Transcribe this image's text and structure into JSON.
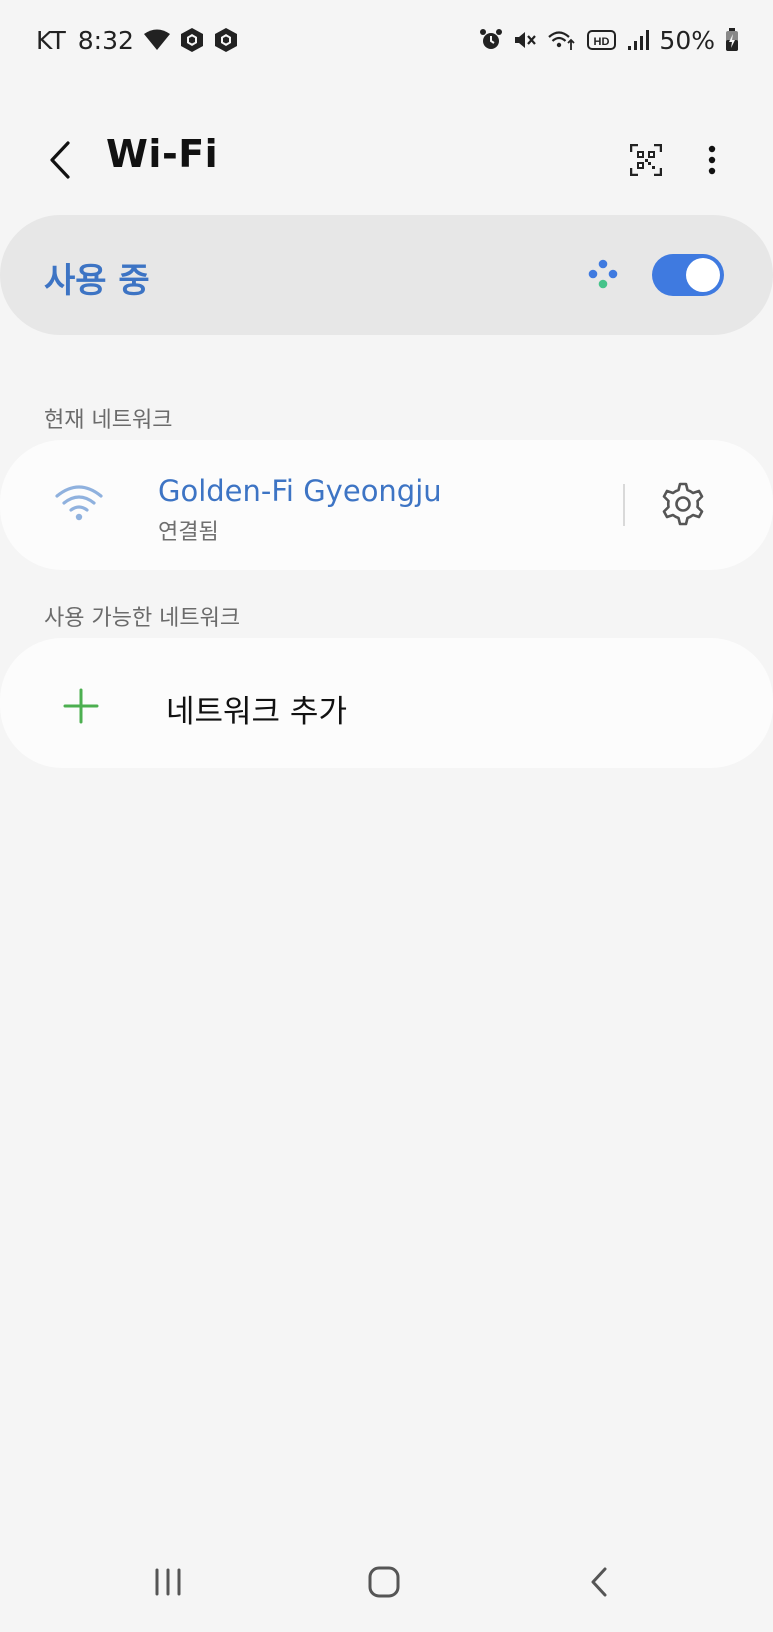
{
  "status_bar": {
    "carrier": "KT",
    "time": "8:32",
    "battery_percent": "50%",
    "hd_label": "HD",
    "icons_left": [
      "wifi-signal-icon",
      "app-notification-icon",
      "app-notification-icon"
    ],
    "icons_right": [
      "alarm-icon",
      "mute-icon",
      "wifi-activity-icon",
      "hd-volte-icon",
      "cell-signal-icon",
      "battery-charging-icon"
    ]
  },
  "header": {
    "title": "Wi-Fi",
    "back_icon": "back-chevron-icon",
    "qr_icon": "qr-scan-icon",
    "more_icon": "more-vertical-icon"
  },
  "master_switch": {
    "label": "사용 중",
    "enabled": true,
    "accent_color": "#3f7ae0"
  },
  "current_network": {
    "section_label": "현재 네트워크",
    "name": "Golden-Fi Gyeongju",
    "status": "연결됨",
    "settings_icon": "gear-icon"
  },
  "available_networks": {
    "section_label": "사용 가능한 네트워크",
    "add_label": "네트워크 추가",
    "add_icon": "plus-icon"
  },
  "nav_bar": {
    "recents_icon": "recents-icon",
    "home_icon": "home-icon",
    "back_icon": "back-icon"
  }
}
